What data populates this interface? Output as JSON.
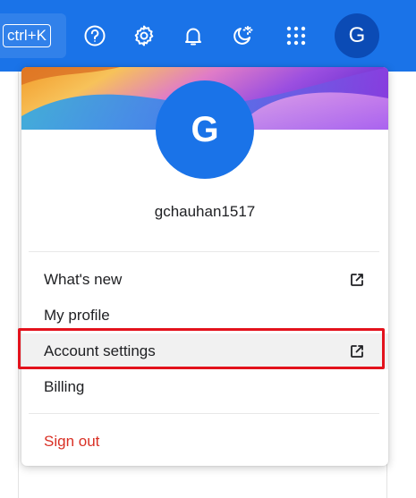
{
  "topbar": {
    "shortcut_label": "ctrl+K",
    "avatar_initial": "G",
    "icons": [
      "help-icon",
      "settings-icon",
      "notifications-icon",
      "theme-icon",
      "apps-icon"
    ]
  },
  "account_menu": {
    "avatar_initial": "G",
    "username": "gchauhan1517",
    "items": [
      {
        "label": "What's new",
        "external": true
      },
      {
        "label": "My profile",
        "external": false
      },
      {
        "label": "Account settings",
        "external": true
      },
      {
        "label": "Billing",
        "external": false
      }
    ],
    "sign_out_label": "Sign out"
  },
  "colors": {
    "brand_blue": "#1a73e8",
    "sign_out": "#d93025",
    "highlight_border": "#e3121c"
  }
}
